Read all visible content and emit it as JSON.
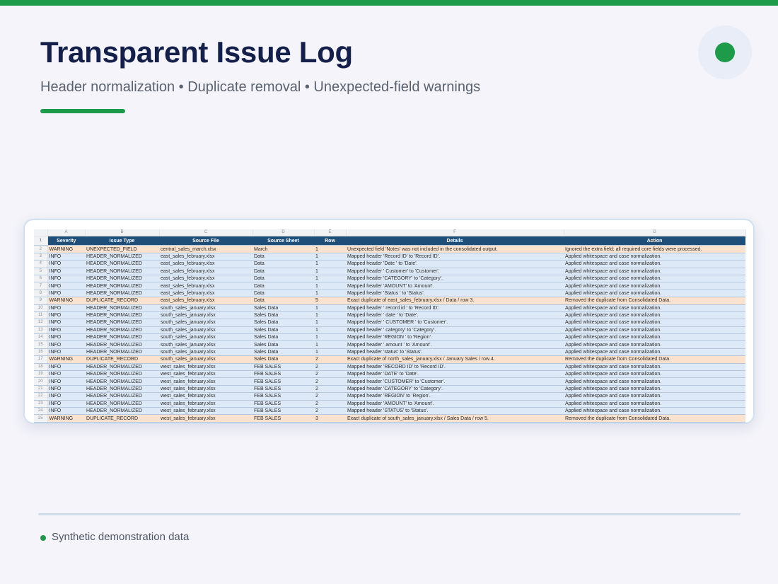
{
  "slide": {
    "title": "Transparent Issue Log",
    "subtitle": "Header normalization • Duplicate removal • Unexpected-field warnings",
    "footer": "Synthetic demonstration data",
    "accent_color": "#1e9a4b",
    "title_color": "#14204a"
  },
  "sheet": {
    "column_letters": [
      "A",
      "B",
      "C",
      "D",
      "E",
      "F",
      "G"
    ],
    "headers": [
      "Severity",
      "Issue Type",
      "Source File",
      "Source Sheet",
      "Row",
      "Details",
      "Action"
    ],
    "header_color": "#1f4e79",
    "info_color": "#dde9f7",
    "warning_color": "#fbe2cf",
    "rows": [
      {
        "n": "2",
        "severity": "WARNING",
        "type": "UNEXPECTED_FIELD",
        "file": "central_sales_march.xlsx",
        "sheet": "March",
        "row": "1",
        "details": "Unexpected field 'Notes' was not included in the consolidated output.",
        "action": "Ignored the extra field; all required core fields were processed."
      },
      {
        "n": "3",
        "severity": "INFO",
        "type": "HEADER_NORMALIZED",
        "file": "east_sales_february.xlsx",
        "sheet": "Data",
        "row": "1",
        "details": "Mapped header 'Record  ID' to 'Record ID'.",
        "action": "Applied whitespace and case normalization."
      },
      {
        "n": "4",
        "severity": "INFO",
        "type": "HEADER_NORMALIZED",
        "file": "east_sales_february.xlsx",
        "sheet": "Data",
        "row": "1",
        "details": "Mapped header 'Date ' to 'Date'.",
        "action": "Applied whitespace and case normalization."
      },
      {
        "n": "5",
        "severity": "INFO",
        "type": "HEADER_NORMALIZED",
        "file": "east_sales_february.xlsx",
        "sheet": "Data",
        "row": "1",
        "details": "Mapped header ' Customer' to 'Customer'.",
        "action": "Applied whitespace and case normalization."
      },
      {
        "n": "6",
        "severity": "INFO",
        "type": "HEADER_NORMALIZED",
        "file": "east_sales_february.xlsx",
        "sheet": "Data",
        "row": "1",
        "details": "Mapped header 'CATEGORY' to 'Category'.",
        "action": "Applied whitespace and case normalization."
      },
      {
        "n": "7",
        "severity": "INFO",
        "type": "HEADER_NORMALIZED",
        "file": "east_sales_february.xlsx",
        "sheet": "Data",
        "row": "1",
        "details": "Mapped header 'AMOUNT' to 'Amount'.",
        "action": "Applied whitespace and case normalization."
      },
      {
        "n": "8",
        "severity": "INFO",
        "type": "HEADER_NORMALIZED",
        "file": "east_sales_february.xlsx",
        "sheet": "Data",
        "row": "1",
        "details": "Mapped header 'Status ' to 'Status'.",
        "action": "Applied whitespace and case normalization."
      },
      {
        "n": "9",
        "severity": "WARNING",
        "type": "DUPLICATE_RECORD",
        "file": "east_sales_february.xlsx",
        "sheet": "Data",
        "row": "5",
        "details": "Exact duplicate of east_sales_february.xlsx / Data / row 3.",
        "action": "Removed the duplicate from Consolidated Data."
      },
      {
        "n": "10",
        "severity": "INFO",
        "type": "HEADER_NORMALIZED",
        "file": "south_sales_january.xlsx",
        "sheet": "Sales Data",
        "row": "1",
        "details": "Mapped header ' record id ' to 'Record ID'.",
        "action": "Applied whitespace and case normalization."
      },
      {
        "n": "11",
        "severity": "INFO",
        "type": "HEADER_NORMALIZED",
        "file": "south_sales_january.xlsx",
        "sheet": "Sales Data",
        "row": "1",
        "details": "Mapped header ' date ' to 'Date'.",
        "action": "Applied whitespace and case normalization."
      },
      {
        "n": "12",
        "severity": "INFO",
        "type": "HEADER_NORMALIZED",
        "file": "south_sales_january.xlsx",
        "sheet": "Sales Data",
        "row": "1",
        "details": "Mapped header ' CUSTOMER ' to 'Customer'.",
        "action": "Applied whitespace and case normalization."
      },
      {
        "n": "13",
        "severity": "INFO",
        "type": "HEADER_NORMALIZED",
        "file": "south_sales_january.xlsx",
        "sheet": "Sales Data",
        "row": "1",
        "details": "Mapped header ' category' to 'Category'.",
        "action": "Applied whitespace and case normalization."
      },
      {
        "n": "14",
        "severity": "INFO",
        "type": "HEADER_NORMALIZED",
        "file": "south_sales_january.xlsx",
        "sheet": "Sales Data",
        "row": "1",
        "details": "Mapped header 'REGION ' to 'Region'.",
        "action": "Applied whitespace and case normalization."
      },
      {
        "n": "15",
        "severity": "INFO",
        "type": "HEADER_NORMALIZED",
        "file": "south_sales_january.xlsx",
        "sheet": "Sales Data",
        "row": "1",
        "details": "Mapped header ' amount ' to 'Amount'.",
        "action": "Applied whitespace and case normalization."
      },
      {
        "n": "16",
        "severity": "INFO",
        "type": "HEADER_NORMALIZED",
        "file": "south_sales_january.xlsx",
        "sheet": "Sales Data",
        "row": "1",
        "details": "Mapped header 'status' to 'Status'.",
        "action": "Applied whitespace and case normalization."
      },
      {
        "n": "17",
        "severity": "WARNING",
        "type": "DUPLICATE_RECORD",
        "file": "south_sales_january.xlsx",
        "sheet": "Sales Data",
        "row": "2",
        "details": "Exact duplicate of north_sales_january.xlsx / January Sales / row 4.",
        "action": "Removed the duplicate from Consolidated Data."
      },
      {
        "n": "18",
        "severity": "INFO",
        "type": "HEADER_NORMALIZED",
        "file": "west_sales_february.xlsx",
        "sheet": "FEB SALES",
        "row": "2",
        "details": "Mapped header 'RECORD ID' to 'Record ID'.",
        "action": "Applied whitespace and case normalization."
      },
      {
        "n": "19",
        "severity": "INFO",
        "type": "HEADER_NORMALIZED",
        "file": "west_sales_february.xlsx",
        "sheet": "FEB SALES",
        "row": "2",
        "details": "Mapped header 'DATE' to 'Date'.",
        "action": "Applied whitespace and case normalization."
      },
      {
        "n": "20",
        "severity": "INFO",
        "type": "HEADER_NORMALIZED",
        "file": "west_sales_february.xlsx",
        "sheet": "FEB SALES",
        "row": "2",
        "details": "Mapped header 'CUSTOMER' to 'Customer'.",
        "action": "Applied whitespace and case normalization."
      },
      {
        "n": "21",
        "severity": "INFO",
        "type": "HEADER_NORMALIZED",
        "file": "west_sales_february.xlsx",
        "sheet": "FEB SALES",
        "row": "2",
        "details": "Mapped header 'CATEGORY' to 'Category'.",
        "action": "Applied whitespace and case normalization."
      },
      {
        "n": "22",
        "severity": "INFO",
        "type": "HEADER_NORMALIZED",
        "file": "west_sales_february.xlsx",
        "sheet": "FEB SALES",
        "row": "2",
        "details": "Mapped header 'REGION' to 'Region'.",
        "action": "Applied whitespace and case normalization."
      },
      {
        "n": "23",
        "severity": "INFO",
        "type": "HEADER_NORMALIZED",
        "file": "west_sales_february.xlsx",
        "sheet": "FEB SALES",
        "row": "2",
        "details": "Mapped header 'AMOUNT' to 'Amount'.",
        "action": "Applied whitespace and case normalization."
      },
      {
        "n": "24",
        "severity": "INFO",
        "type": "HEADER_NORMALIZED",
        "file": "west_sales_february.xlsx",
        "sheet": "FEB SALES",
        "row": "2",
        "details": "Mapped header 'STATUS' to 'Status'.",
        "action": "Applied whitespace and case normalization."
      },
      {
        "n": "25",
        "severity": "WARNING",
        "type": "DUPLICATE_RECORD",
        "file": "west_sales_february.xlsx",
        "sheet": "FEB SALES",
        "row": "3",
        "details": "Exact duplicate of south_sales_january.xlsx / Sales Data / row 5.",
        "action": "Removed the duplicate from Consolidated Data."
      }
    ]
  }
}
